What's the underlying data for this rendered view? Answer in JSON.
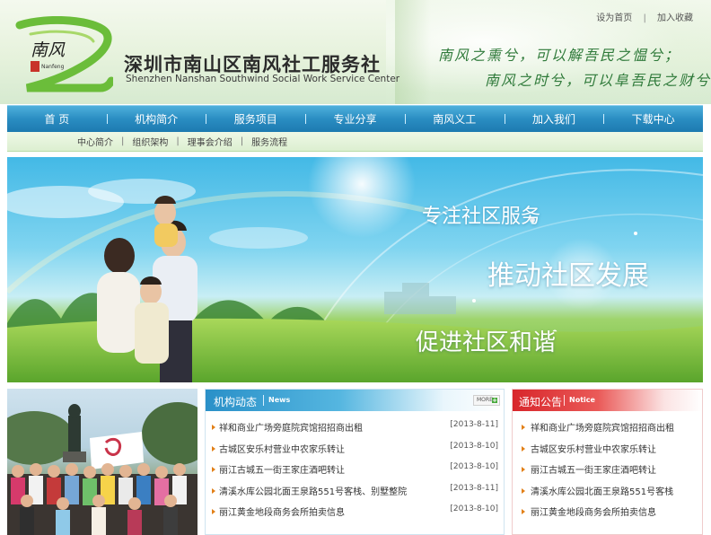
{
  "header": {
    "top_links": [
      "设为首页",
      "加入收藏"
    ],
    "logo_text": "南风",
    "logo_sub": "Nanfeng",
    "title": "深圳市南山区南风社工服务社",
    "subtitle": "Shenzhen Nanshan Southwind Social Work Service Center",
    "slogan_1": "南风之熏兮，可以解吾民之愠兮；",
    "slogan_2": "南风之时兮，可以阜吾民之财兮"
  },
  "nav": {
    "items": [
      "首 页",
      "机构简介",
      "服务项目",
      "专业分享",
      "南风义工",
      "加入我们",
      "下载中心"
    ]
  },
  "subnav": {
    "items": [
      "中心简介",
      "组织架构",
      "理事会介绍",
      "服务流程"
    ]
  },
  "banner": {
    "line_1": "专注社区服务",
    "line_2": "推动社区发展",
    "line_3": "促进社区和谐"
  },
  "news": {
    "title": "机构动态",
    "title_en": "News",
    "more_label": "MORE",
    "items": [
      {
        "text": "祥和商业广场旁庭院宾馆招招商出租",
        "date": "[2013-8-11]"
      },
      {
        "text": "古城区安乐村营业中农家乐转让",
        "date": "[2013-8-10]"
      },
      {
        "text": "丽江古城五一街王家庄酒吧转让",
        "date": "[2013-8-10]"
      },
      {
        "text": "清溪水库公园北面王泉路551号客栈、别墅整院",
        "date": "[2013-8-11]"
      },
      {
        "text": "丽江黄金地段商务会所拍卖信息",
        "date": "[2013-8-10]"
      }
    ]
  },
  "notice": {
    "title": "通知公告",
    "title_en": "Notice",
    "items": [
      "祥和商业广场旁庭院宾馆招招商出租",
      "古城区安乐村营业中农家乐转让",
      "丽江古城五一街王家庄酒吧转让",
      "清溪水库公园北面王泉路551号客栈",
      "丽江黄金地段商务会所拍卖信息"
    ]
  },
  "colors": {
    "nav_blue": "#2a8dc2",
    "news_blue": "#2a90c8",
    "notice_red": "#d8262b",
    "bullet_orange": "#e28018",
    "slogan_green": "#2f7a3a"
  }
}
